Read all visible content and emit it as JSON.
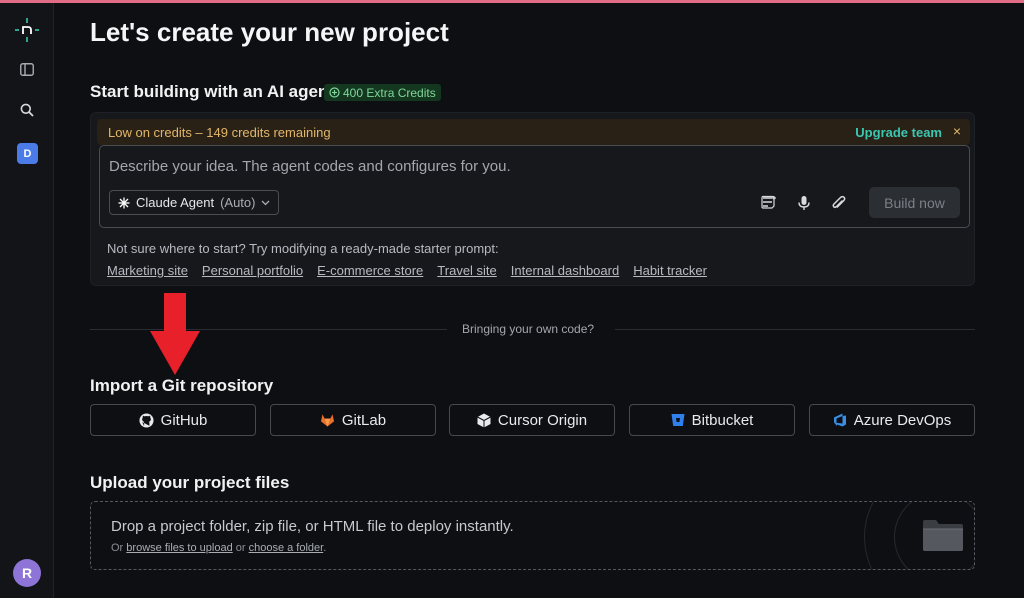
{
  "page": {
    "title": "Let's create your new project"
  },
  "sidebar": {
    "logo": "netlify-logo-icon",
    "workspace_initial": "D",
    "user_initial": "R",
    "icons": [
      "sidebar-panel-icon",
      "search-icon"
    ]
  },
  "agent_section": {
    "heading": "Start building with an AI agent",
    "extra_credits": "400 Extra Credits",
    "low_credits_text": "Low on credits – 149 credits remaining",
    "upgrade_label": "Upgrade team",
    "close_label": "×",
    "prompt_placeholder": "Describe your idea. The agent codes and configures for you.",
    "agent_name": "Claude Agent",
    "agent_mode": "(Auto)",
    "build_label": "Build now",
    "starter_label": "Not sure where to start? Try modifying a ready-made starter prompt:",
    "starters": [
      "Marketing site",
      "Personal portfolio",
      "E-commerce store",
      "Travel site",
      "Internal dashboard",
      "Habit tracker"
    ]
  },
  "divider_text": "Bringing your own code?",
  "git_section": {
    "heading": "Import a Git repository",
    "providers": [
      {
        "label": "GitHub",
        "icon": "github-icon"
      },
      {
        "label": "GitLab",
        "icon": "gitlab-icon"
      },
      {
        "label": "Cursor Origin",
        "icon": "cursor-icon"
      },
      {
        "label": "Bitbucket",
        "icon": "bitbucket-icon"
      },
      {
        "label": "Azure DevOps",
        "icon": "azure-devops-icon"
      }
    ]
  },
  "upload_section": {
    "heading": "Upload your project files",
    "drop_text": "Drop a project folder, zip file, or HTML file to deploy instantly.",
    "or_1": "Or",
    "browse_link": "browse files to upload",
    "or_2": "or",
    "folder_link": "choose a folder",
    "period": "."
  },
  "colors": {
    "accent_teal": "#3cc6b0",
    "warning_amber": "#e2b66a",
    "annotation_red": "#e8202a",
    "gitlab_orange": "#e8702a",
    "bitbucket_blue": "#2f80ed",
    "azure_blue": "#3a8ee6"
  }
}
